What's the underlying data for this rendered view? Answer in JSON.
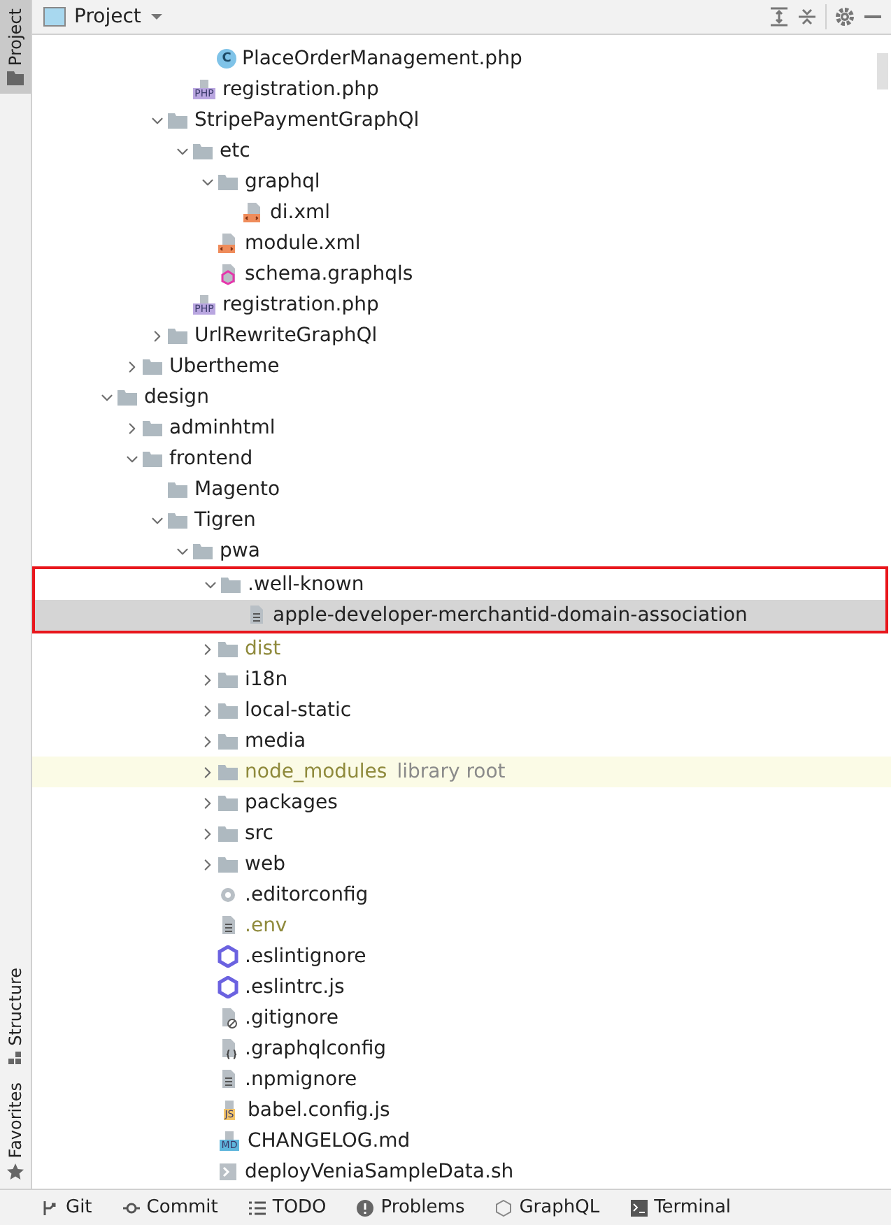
{
  "side_tabs_top": [
    {
      "label": "Project",
      "selected": true
    }
  ],
  "side_tabs_bottom": [
    {
      "label": "Structure",
      "kind": "structure",
      "selected": false
    },
    {
      "label": "Favorites",
      "kind": "favorites",
      "selected": false
    }
  ],
  "panel": {
    "title": "Project"
  },
  "tree": [
    {
      "children": [
        {
          "children": [
            {
              "children": [
                {
                  "children": [
                    {
                      "label": "PlaceOrderManagement.php",
                      "kind": "class",
                      "badge": "C",
                      "selected": false,
                      "excluded": false
                    }
                  ]
                },
                {
                  "label": "registration.php",
                  "kind": "php",
                  "badge": "PHP",
                  "selected": false,
                  "excluded": false
                }
              ]
            },
            {
              "label": "StripePaymentGraphQl",
              "kind": "folder",
              "expanded": true,
              "selected": false,
              "excluded": false,
              "children": [
                {
                  "label": "etc",
                  "kind": "folder",
                  "expanded": true,
                  "selected": false,
                  "excluded": false,
                  "children": [
                    {
                      "label": "graphql",
                      "kind": "folder",
                      "expanded": true,
                      "selected": false,
                      "excluded": false,
                      "children": [
                        {
                          "label": "di.xml",
                          "kind": "xml",
                          "selected": false,
                          "excluded": false
                        }
                      ]
                    },
                    {
                      "label": "module.xml",
                      "kind": "xml",
                      "selected": false,
                      "excluded": false
                    },
                    {
                      "label": "schema.graphqls",
                      "kind": "graphqls",
                      "selected": false,
                      "excluded": false
                    }
                  ]
                },
                {
                  "label": "registration.php",
                  "kind": "php",
                  "badge": "PHP",
                  "selected": false,
                  "excluded": false
                }
              ]
            },
            {
              "label": "UrlRewriteGraphQl",
              "kind": "folder",
              "expanded": false,
              "selected": false,
              "excluded": false
            }
          ]
        },
        {
          "label": "Ubertheme",
          "kind": "folder",
          "expanded": false,
          "selected": false,
          "excluded": false
        }
      ]
    },
    {
      "label": "design",
      "kind": "folder",
      "expanded": true,
      "selected": false,
      "excluded": false,
      "children": [
        {
          "label": "adminhtml",
          "kind": "folder",
          "expanded": false,
          "selected": false,
          "excluded": false
        },
        {
          "label": "frontend",
          "kind": "folder",
          "expanded": true,
          "selected": false,
          "excluded": false,
          "children": [
            {
              "label": "Magento",
              "kind": "folder",
              "selected": false,
              "excluded": false
            },
            {
              "label": "Tigren",
              "kind": "folder",
              "expanded": true,
              "selected": false,
              "excluded": false,
              "children": [
                {
                  "label": "pwa",
                  "kind": "folder",
                  "expanded": true,
                  "selected": false,
                  "excluded": false,
                  "children": [
                    {
                      "label": ".well-known",
                      "kind": "folder",
                      "expanded": true,
                      "selected": false,
                      "excluded": false,
                      "outlined": true,
                      "children": [
                        {
                          "label": "apple-developer-merchantid-domain-association",
                          "kind": "text",
                          "selected": true,
                          "excluded": false
                        }
                      ]
                    },
                    {
                      "label": "dist",
                      "kind": "folder",
                      "expanded": false,
                      "selected": false,
                      "excluded": true
                    },
                    {
                      "label": "i18n",
                      "kind": "folder",
                      "expanded": false,
                      "selected": false,
                      "excluded": false
                    },
                    {
                      "label": "local-static",
                      "kind": "folder",
                      "expanded": false,
                      "selected": false,
                      "excluded": false
                    },
                    {
                      "label": "media",
                      "kind": "folder",
                      "expanded": false,
                      "selected": false,
                      "excluded": false
                    },
                    {
                      "label": "node_modules",
                      "kind": "folder",
                      "expanded": false,
                      "selected": false,
                      "excluded": true,
                      "suffix": "library root"
                    },
                    {
                      "label": "packages",
                      "kind": "folder",
                      "expanded": false,
                      "selected": false,
                      "excluded": false
                    },
                    {
                      "label": "src",
                      "kind": "folder",
                      "expanded": false,
                      "selected": false,
                      "excluded": false
                    },
                    {
                      "label": "web",
                      "kind": "folder",
                      "expanded": false,
                      "selected": false,
                      "excluded": false
                    },
                    {
                      "label": ".editorconfig",
                      "kind": "config",
                      "selected": false,
                      "excluded": false
                    },
                    {
                      "label": ".env",
                      "kind": "text",
                      "selected": false,
                      "excluded": true
                    },
                    {
                      "label": ".eslintignore",
                      "kind": "eslint",
                      "selected": false,
                      "excluded": false
                    },
                    {
                      "label": ".eslintrc.js",
                      "kind": "eslint",
                      "selected": false,
                      "excluded": false
                    },
                    {
                      "label": ".gitignore",
                      "kind": "gitignore",
                      "selected": false,
                      "excluded": false
                    },
                    {
                      "label": ".graphqlconfig",
                      "kind": "graphqlconfig",
                      "selected": false,
                      "excluded": false
                    },
                    {
                      "label": ".npmignore",
                      "kind": "text",
                      "selected": false,
                      "excluded": false
                    },
                    {
                      "label": "babel.config.js",
                      "kind": "js",
                      "badge": "JS",
                      "selected": false,
                      "excluded": false
                    },
                    {
                      "label": "CHANGELOG.md",
                      "kind": "md",
                      "badge": "MD",
                      "selected": false,
                      "excluded": false
                    },
                    {
                      "label": "deployVeniaSampleData.sh",
                      "kind": "shell",
                      "selected": false,
                      "excluded": false
                    }
                  ]
                }
              ]
            }
          ]
        }
      ]
    }
  ],
  "bottom_tools": [
    {
      "label": "Git",
      "kind": "git"
    },
    {
      "label": "Commit",
      "kind": "commit"
    },
    {
      "label": "TODO",
      "kind": "todo"
    },
    {
      "label": "Problems",
      "kind": "problems"
    },
    {
      "label": "GraphQL",
      "kind": "graphql"
    },
    {
      "label": "Terminal",
      "kind": "terminal"
    }
  ]
}
